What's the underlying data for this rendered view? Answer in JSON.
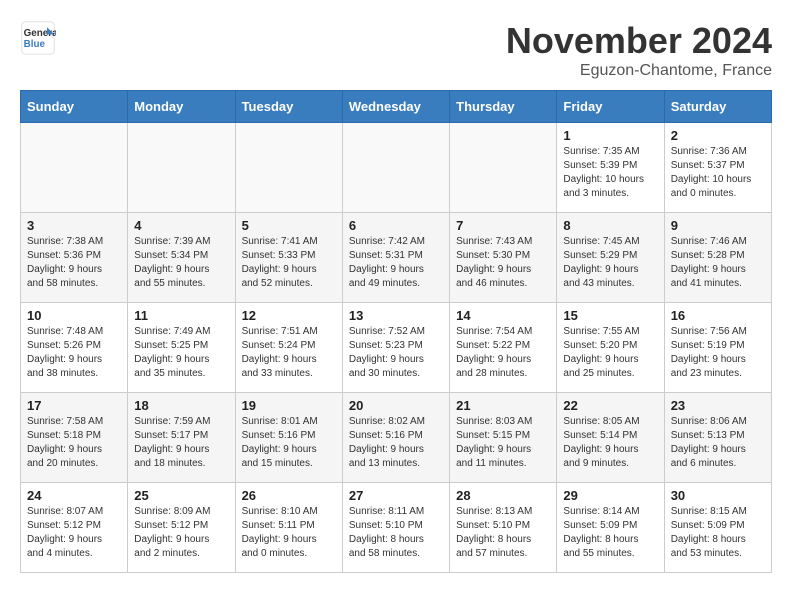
{
  "header": {
    "logo_line1": "General",
    "logo_line2": "Blue",
    "month_year": "November 2024",
    "location": "Eguzon-Chantome, France"
  },
  "days_of_week": [
    "Sunday",
    "Monday",
    "Tuesday",
    "Wednesday",
    "Thursday",
    "Friday",
    "Saturday"
  ],
  "weeks": [
    [
      {
        "day": "",
        "info": ""
      },
      {
        "day": "",
        "info": ""
      },
      {
        "day": "",
        "info": ""
      },
      {
        "day": "",
        "info": ""
      },
      {
        "day": "",
        "info": ""
      },
      {
        "day": "1",
        "info": "Sunrise: 7:35 AM\nSunset: 5:39 PM\nDaylight: 10 hours\nand 3 minutes."
      },
      {
        "day": "2",
        "info": "Sunrise: 7:36 AM\nSunset: 5:37 PM\nDaylight: 10 hours\nand 0 minutes."
      }
    ],
    [
      {
        "day": "3",
        "info": "Sunrise: 7:38 AM\nSunset: 5:36 PM\nDaylight: 9 hours\nand 58 minutes."
      },
      {
        "day": "4",
        "info": "Sunrise: 7:39 AM\nSunset: 5:34 PM\nDaylight: 9 hours\nand 55 minutes."
      },
      {
        "day": "5",
        "info": "Sunrise: 7:41 AM\nSunset: 5:33 PM\nDaylight: 9 hours\nand 52 minutes."
      },
      {
        "day": "6",
        "info": "Sunrise: 7:42 AM\nSunset: 5:31 PM\nDaylight: 9 hours\nand 49 minutes."
      },
      {
        "day": "7",
        "info": "Sunrise: 7:43 AM\nSunset: 5:30 PM\nDaylight: 9 hours\nand 46 minutes."
      },
      {
        "day": "8",
        "info": "Sunrise: 7:45 AM\nSunset: 5:29 PM\nDaylight: 9 hours\nand 43 minutes."
      },
      {
        "day": "9",
        "info": "Sunrise: 7:46 AM\nSunset: 5:28 PM\nDaylight: 9 hours\nand 41 minutes."
      }
    ],
    [
      {
        "day": "10",
        "info": "Sunrise: 7:48 AM\nSunset: 5:26 PM\nDaylight: 9 hours\nand 38 minutes."
      },
      {
        "day": "11",
        "info": "Sunrise: 7:49 AM\nSunset: 5:25 PM\nDaylight: 9 hours\nand 35 minutes."
      },
      {
        "day": "12",
        "info": "Sunrise: 7:51 AM\nSunset: 5:24 PM\nDaylight: 9 hours\nand 33 minutes."
      },
      {
        "day": "13",
        "info": "Sunrise: 7:52 AM\nSunset: 5:23 PM\nDaylight: 9 hours\nand 30 minutes."
      },
      {
        "day": "14",
        "info": "Sunrise: 7:54 AM\nSunset: 5:22 PM\nDaylight: 9 hours\nand 28 minutes."
      },
      {
        "day": "15",
        "info": "Sunrise: 7:55 AM\nSunset: 5:20 PM\nDaylight: 9 hours\nand 25 minutes."
      },
      {
        "day": "16",
        "info": "Sunrise: 7:56 AM\nSunset: 5:19 PM\nDaylight: 9 hours\nand 23 minutes."
      }
    ],
    [
      {
        "day": "17",
        "info": "Sunrise: 7:58 AM\nSunset: 5:18 PM\nDaylight: 9 hours\nand 20 minutes."
      },
      {
        "day": "18",
        "info": "Sunrise: 7:59 AM\nSunset: 5:17 PM\nDaylight: 9 hours\nand 18 minutes."
      },
      {
        "day": "19",
        "info": "Sunrise: 8:01 AM\nSunset: 5:16 PM\nDaylight: 9 hours\nand 15 minutes."
      },
      {
        "day": "20",
        "info": "Sunrise: 8:02 AM\nSunset: 5:16 PM\nDaylight: 9 hours\nand 13 minutes."
      },
      {
        "day": "21",
        "info": "Sunrise: 8:03 AM\nSunset: 5:15 PM\nDaylight: 9 hours\nand 11 minutes."
      },
      {
        "day": "22",
        "info": "Sunrise: 8:05 AM\nSunset: 5:14 PM\nDaylight: 9 hours\nand 9 minutes."
      },
      {
        "day": "23",
        "info": "Sunrise: 8:06 AM\nSunset: 5:13 PM\nDaylight: 9 hours\nand 6 minutes."
      }
    ],
    [
      {
        "day": "24",
        "info": "Sunrise: 8:07 AM\nSunset: 5:12 PM\nDaylight: 9 hours\nand 4 minutes."
      },
      {
        "day": "25",
        "info": "Sunrise: 8:09 AM\nSunset: 5:12 PM\nDaylight: 9 hours\nand 2 minutes."
      },
      {
        "day": "26",
        "info": "Sunrise: 8:10 AM\nSunset: 5:11 PM\nDaylight: 9 hours\nand 0 minutes."
      },
      {
        "day": "27",
        "info": "Sunrise: 8:11 AM\nSunset: 5:10 PM\nDaylight: 8 hours\nand 58 minutes."
      },
      {
        "day": "28",
        "info": "Sunrise: 8:13 AM\nSunset: 5:10 PM\nDaylight: 8 hours\nand 57 minutes."
      },
      {
        "day": "29",
        "info": "Sunrise: 8:14 AM\nSunset: 5:09 PM\nDaylight: 8 hours\nand 55 minutes."
      },
      {
        "day": "30",
        "info": "Sunrise: 8:15 AM\nSunset: 5:09 PM\nDaylight: 8 hours\nand 53 minutes."
      }
    ]
  ]
}
